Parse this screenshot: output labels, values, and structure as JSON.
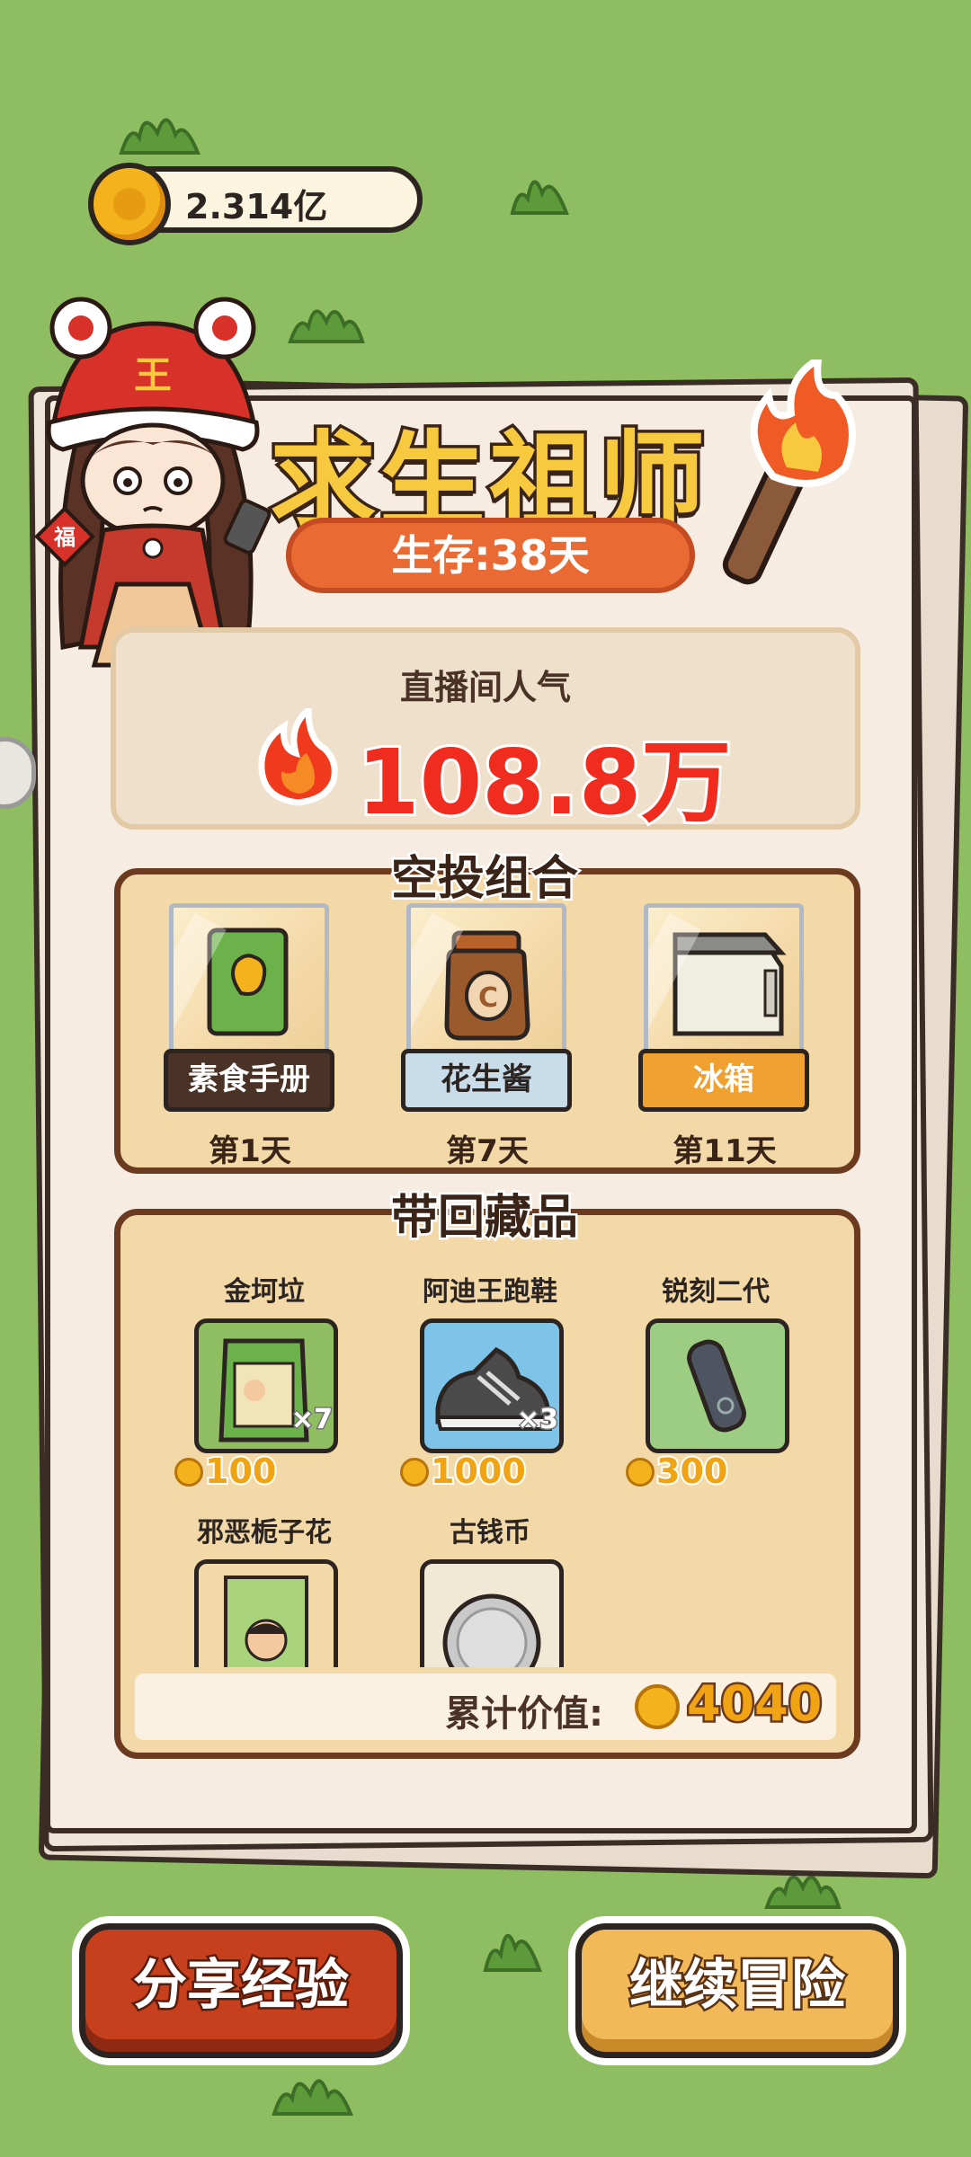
{
  "top": {
    "coin_amount": "2.314亿"
  },
  "header": {
    "title": "求生祖师",
    "survival": "生存:38天"
  },
  "popularity": {
    "label": "直播间人气",
    "value": "108.8万"
  },
  "airdrop": {
    "title": "空投组合",
    "items": [
      {
        "name": "素食手册",
        "day": "第1天",
        "label_bg": "#4a3326",
        "label_color": "#ffffff"
      },
      {
        "name": "花生酱",
        "day": "第7天",
        "label_bg": "#c9dcea",
        "label_color": "#2b2420"
      },
      {
        "name": "冰箱",
        "day": "第11天",
        "label_bg": "#f0a02e",
        "label_color": "#ffffff"
      }
    ]
  },
  "collection": {
    "title": "带回藏品",
    "items": [
      {
        "name": "金坷垃",
        "count": "×7",
        "price": "100"
      },
      {
        "name": "阿迪王跑鞋",
        "count": "×3",
        "price": "1000"
      },
      {
        "name": "锐刻二代",
        "count": "",
        "price": "300"
      },
      {
        "name": "邪恶栀子花",
        "count": "",
        "price": ""
      },
      {
        "name": "古钱币",
        "count": "",
        "price": ""
      }
    ],
    "total_label": "累计价值:",
    "total_value": "4040"
  },
  "buttons": {
    "share": "分享经验",
    "continue": "继续冒险"
  },
  "colors": {
    "background": "#8fbd62",
    "accent_red": "#ef2c1e",
    "frame_brown": "#6b3a1f"
  }
}
